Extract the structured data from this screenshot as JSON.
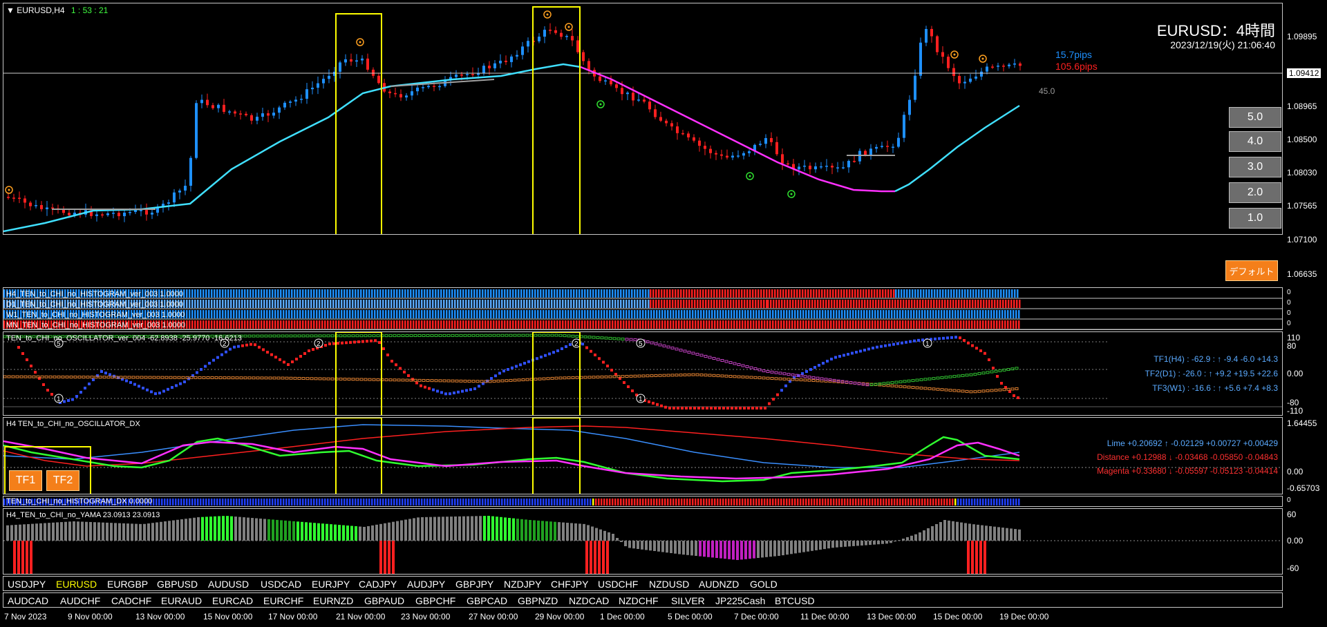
{
  "chart_header": {
    "symbol": "EURUSD,H4",
    "countdown": "1 : 53 : 21"
  },
  "overlay": {
    "title": "EURUSD：4時間",
    "datetime": "2023/12/19(火) 21:06:40",
    "pips1": "15.7pips",
    "pips2": "105.6pips",
    "label_45": "45.0"
  },
  "price_axis": [
    "1.09895",
    "1.09412",
    "1.08965",
    "1.08500",
    "1.08030",
    "1.07565",
    "1.07100",
    "1.06635"
  ],
  "current_price": "1.09412",
  "period_buttons": [
    "5.0",
    "4.0",
    "3.0",
    "2.0",
    "1.0"
  ],
  "default_button": "デフォルト",
  "histo_panels": [
    "H4_TEN_to_CHI_no_HISTOGRAM_ver_003 1.0000",
    "D1_TEN_to_CHI_no_HISTOGRAM_ver_003 1.0000",
    "W1_TEN_to_CHI_no_HISTOGRAM_ver_003 1.0000",
    "MN_TEN_to_CHI_no_HISTOGRAM_ver_003 1.0000"
  ],
  "histo_axis": [
    "0",
    "0",
    "0",
    "0"
  ],
  "osc": {
    "title": "TEN_to_CHI_no_OSCILLATOR_ver_004 -62.8938 -25.9770 -16.6213",
    "axis": [
      "110",
      "80",
      "0.00",
      "-80",
      "-110"
    ],
    "rows": [
      "TF1(H4) : -62.9 : ↑ -9.4 -6.0 +14.3",
      "TF2(D1) : -26.0 : ↑ +9.2 +19.5 +22.6",
      "TF3(W1) : -16.6 : ↑ +5.6 +7.4 +8.3"
    ]
  },
  "dx": {
    "title": "H4 TEN_to_CHI_no_OSCILLATOR_DX",
    "axis": [
      "1.64455",
      "0.00",
      "-0.65703"
    ],
    "rows": [
      "Lime +0.20692 ↑ -0.02129 +0.00727 +0.00429",
      "Distance +0.12988 ↓ -0.03468 -0.05850 -0.04843",
      "Magenta +0.33680 ↓ -0.05597 -0.05123 -0.04414"
    ],
    "buttons": [
      "TF1",
      "TF2"
    ]
  },
  "histo_dx": {
    "title": "TEN_to_CHI_no_HISTOGRAM_DX 0.0000",
    "axis": "0"
  },
  "yama": {
    "title": "H4_TEN_to_CHI_no_YAMA 23.0913 23.0913",
    "axis": [
      "60",
      "0.00",
      "-60"
    ]
  },
  "symbols_row1": [
    "USDJPY",
    "EURUSD",
    "EURGBP",
    "GBPUSD",
    "AUDUSD",
    "USDCAD",
    "EURJPY",
    "CADJPY",
    "AUDJPY",
    "GBPJPY",
    "NZDJPY",
    "CHFJPY",
    "USDCHF",
    "NZDUSD",
    "AUDNZD",
    "GOLD"
  ],
  "symbols_row2": [
    "AUDCAD",
    "AUDCHF",
    "CADCHF",
    "EURAUD",
    "EURCAD",
    "EURCHF",
    "EURNZD",
    "GBPAUD",
    "GBPCHF",
    "GBPCAD",
    "GBPNZD",
    "NZDCAD",
    "NZDCHF",
    "SILVER",
    "JP225Cash",
    "BTCUSD"
  ],
  "active_symbol": "EURUSD",
  "time_axis": [
    "7 Nov 2023",
    "9 Nov 00:00",
    "13 Nov 00:00",
    "15 Nov 00:00",
    "17 Nov 00:00",
    "21 Nov 00:00",
    "23 Nov 00:00",
    "27 Nov 00:00",
    "29 Nov 00:00",
    "1 Dec 00:00",
    "5 Dec 00:00",
    "7 Dec 00:00",
    "11 Dec 00:00",
    "13 Dec 00:00",
    "15 Dec 00:00",
    "19 Dec 00:00"
  ],
  "colors": {
    "bull": "#1e90ff",
    "bear": "#ff2020",
    "ma_fast": "#40e0ff",
    "ma_slow": "#ff30ff",
    "highlight": "#ffff00",
    "button_orange": "#f47f1a"
  }
}
